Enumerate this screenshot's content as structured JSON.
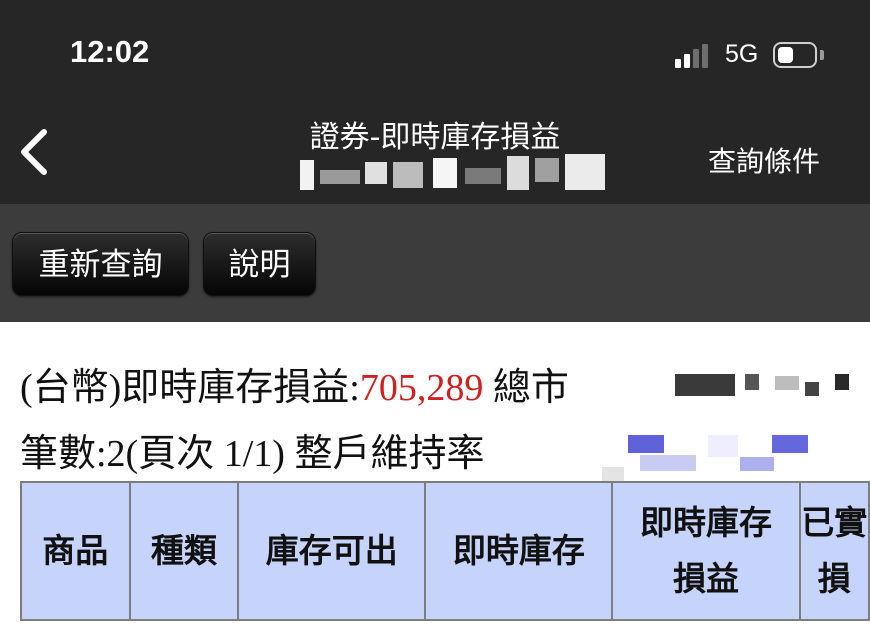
{
  "status_bar": {
    "time": "12:02",
    "network": "5G",
    "signal_bars_active": 2,
    "signal_bars_total": 4
  },
  "nav": {
    "title": "證券-即時庫存損益",
    "query_conditions": "查詢條件"
  },
  "toolbar": {
    "requery_label": "重新查詢",
    "help_label": "說明"
  },
  "summary": {
    "pnl_label": "(台幣)即時庫存損益:",
    "pnl_value": "705,289",
    "total_market_label": "總市",
    "count_label": "筆數:2(頁次 1/1)",
    "maintenance_label": "整戶維持率"
  },
  "table": {
    "headers": [
      {
        "line1": "商品",
        "line2": ""
      },
      {
        "line1": "種類",
        "line2": ""
      },
      {
        "line1": "庫存可出",
        "line2": ""
      },
      {
        "line1": "即時庫存",
        "line2": ""
      },
      {
        "line1": "即時庫存",
        "line2": "損益"
      },
      {
        "line1": "已實",
        "line2": "損"
      }
    ]
  },
  "colors": {
    "dark_bar": "#262626",
    "toolbar": "#3c3c3c",
    "header_bg": "#c6d3fb",
    "value_red": "#d22020"
  }
}
